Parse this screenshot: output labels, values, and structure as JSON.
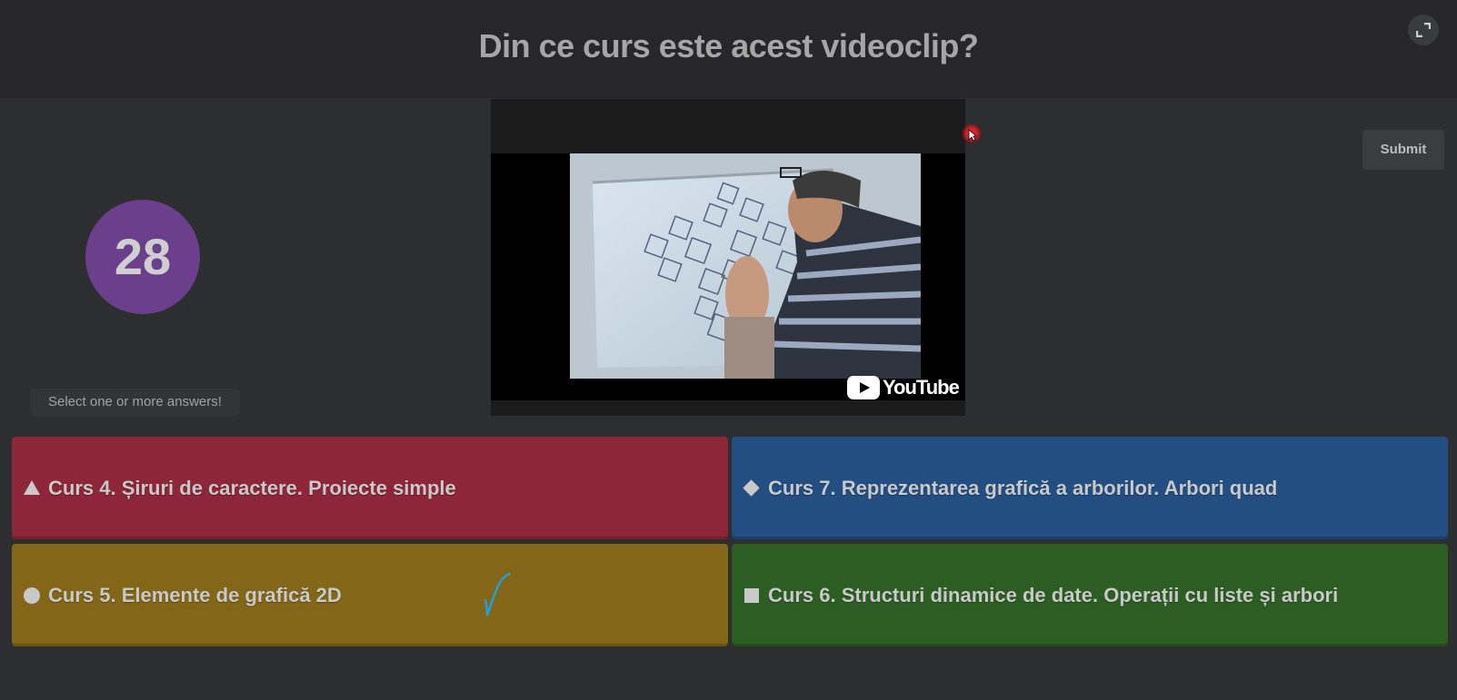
{
  "question": "Din ce curs este acest videoclip?",
  "timer": "28",
  "hint": "Select one or more answers!",
  "submit_label": "Submit",
  "video": {
    "provider_logo_text": "YouTube"
  },
  "answers": [
    {
      "label": "Curs 4. Șiruri de caractere. Proiecte simple",
      "shape": "triangle-icon",
      "color": "#8d2638"
    },
    {
      "label": "Curs 7. Reprezentarea grafică a arborilor. Arbori quad",
      "shape": "diamond-icon",
      "color": "#234e81"
    },
    {
      "label": "Curs 5. Elemente de grafică 2D",
      "shape": "circle-icon",
      "color": "#836617",
      "annotated_check": true
    },
    {
      "label": "Curs 6. Structuri dinamice de date. Operații cu liste și arbori",
      "shape": "square-icon",
      "color": "#2c5d22"
    }
  ]
}
